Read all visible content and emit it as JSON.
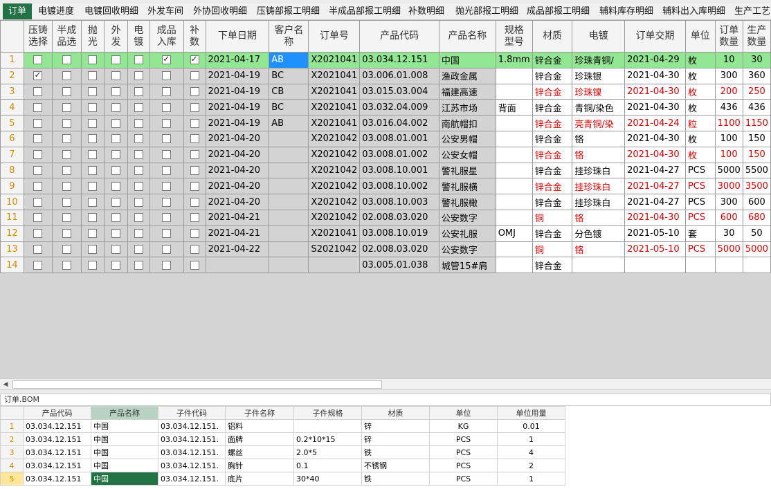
{
  "tabs": [
    {
      "label": "订单",
      "active": true
    },
    {
      "label": "电镀进度"
    },
    {
      "label": "电镀回收明细"
    },
    {
      "label": "外发车间"
    },
    {
      "label": "外协回收明细"
    },
    {
      "label": "压铸部报工明细"
    },
    {
      "label": "半成品部报工明细"
    },
    {
      "label": "补数明细"
    },
    {
      "label": "抛光部报工明细"
    },
    {
      "label": "成品部报工明细"
    },
    {
      "label": "辅料库存明细"
    },
    {
      "label": "辅料出入库明细"
    },
    {
      "label": "生产工艺"
    }
  ],
  "columns": [
    "压铸选择",
    "半成品选",
    "抛光",
    "外发",
    "电镀",
    "成品入库",
    "补数",
    "下单日期",
    "客户名称",
    "订单号",
    "产品代码",
    "产品名称",
    "规格型号",
    "材质",
    "电镀",
    "订单交期",
    "单位",
    "订单数量",
    "生产数量"
  ],
  "column_headers": [
    "压铸\n选择",
    "半成\n品选",
    "抛\n光",
    "外\n发",
    "电\n镀",
    "成品\n入库",
    "补\n数",
    "下单日期",
    "客户名\n称",
    "订单号",
    "产品代码",
    "产品名称",
    "规格\n型号",
    "材质",
    "电镀",
    "订单交期",
    "单位",
    "订单\n数量",
    "生产\n数量"
  ],
  "rows": [
    {
      "n": "1",
      "checks": [
        0,
        0,
        0,
        0,
        0,
        1,
        1
      ],
      "date": "2021-04-17",
      "customer": "AB",
      "order": "X2021041",
      "code": "03.034.12.151",
      "name": "中国",
      "spec": "1.8mm",
      "material": "锌合金",
      "plating": "珍珠青铜/",
      "due": "2021-04-29",
      "unit": "枚",
      "qty": "10",
      "prod": "30",
      "red": false,
      "selected": true
    },
    {
      "n": "2",
      "checks": [
        1,
        0,
        0,
        0,
        0,
        0,
        0
      ],
      "date": "2021-04-19",
      "customer": "BC",
      "order": "X2021041",
      "code": "03.006.01.008",
      "name": "渔政金属",
      "spec": "",
      "material": "锌合金",
      "plating": "珍珠银",
      "due": "2021-04-30",
      "unit": "枚",
      "qty": "300",
      "prod": "360",
      "red": false
    },
    {
      "n": "3",
      "checks": [
        0,
        0,
        0,
        0,
        0,
        0,
        0
      ],
      "date": "2021-04-19",
      "customer": "CB",
      "order": "X2021041",
      "code": "03.015.03.004",
      "name": "福建高速",
      "spec": "",
      "material": "锌合金",
      "plating": "珍珠镍",
      "due": "2021-04-30",
      "unit": "枚",
      "qty": "200",
      "prod": "250",
      "red": true
    },
    {
      "n": "4",
      "checks": [
        0,
        0,
        0,
        0,
        0,
        0,
        0
      ],
      "date": "2021-04-19",
      "customer": "BC",
      "order": "X2021041",
      "code": "03.032.04.009",
      "name": "江苏市场",
      "spec": "背面",
      "material": "锌合金",
      "plating": "青铜/染色",
      "due": "2021-04-30",
      "unit": "枚",
      "qty": "436",
      "prod": "436",
      "red": false
    },
    {
      "n": "5",
      "checks": [
        0,
        0,
        0,
        0,
        0,
        0,
        0
      ],
      "date": "2021-04-19",
      "customer": "AB",
      "order": "X2021041",
      "code": "03.016.04.002",
      "name": "南航帽扣",
      "spec": "",
      "material": "锌合金",
      "plating": "亮青铜/染",
      "due": "2021-04-24",
      "unit": "粒",
      "qty": "1100",
      "prod": "1150",
      "red": true
    },
    {
      "n": "6",
      "checks": [
        0,
        0,
        0,
        0,
        0,
        0,
        0
      ],
      "date": "2021-04-20",
      "customer": "",
      "order": "X2021042",
      "code": "03.008.01.001",
      "name": "公安男帽",
      "spec": "",
      "material": "锌合金",
      "plating": "铬",
      "due": "2021-04-30",
      "unit": "枚",
      "qty": "100",
      "prod": "150",
      "red": false
    },
    {
      "n": "7",
      "checks": [
        0,
        0,
        0,
        0,
        0,
        0,
        0
      ],
      "date": "2021-04-20",
      "customer": "",
      "order": "X2021042",
      "code": "03.008.01.002",
      "name": "公安女帽",
      "spec": "",
      "material": "锌合金",
      "plating": "铬",
      "due": "2021-04-30",
      "unit": "枚",
      "qty": "100",
      "prod": "150",
      "red": true
    },
    {
      "n": "8",
      "checks": [
        0,
        0,
        0,
        0,
        0,
        0,
        0
      ],
      "date": "2021-04-20",
      "customer": "",
      "order": "X2021042",
      "code": "03.008.10.001",
      "name": "警礼服星",
      "spec": "",
      "material": "锌合金",
      "plating": "挂珍珠白",
      "due": "2021-04-27",
      "unit": "PCS",
      "qty": "5000",
      "prod": "5500",
      "red": false
    },
    {
      "n": "9",
      "checks": [
        0,
        0,
        0,
        0,
        0,
        0,
        0
      ],
      "date": "2021-04-20",
      "customer": "",
      "order": "X2021042",
      "code": "03.008.10.002",
      "name": "警礼服横",
      "spec": "",
      "material": "锌合金",
      "plating": "挂珍珠白",
      "due": "2021-04-27",
      "unit": "PCS",
      "qty": "3000",
      "prod": "3500",
      "red": true
    },
    {
      "n": "10",
      "checks": [
        0,
        0,
        0,
        0,
        0,
        0,
        0
      ],
      "date": "2021-04-20",
      "customer": "",
      "order": "X2021042",
      "code": "03.008.10.003",
      "name": "警礼服橄",
      "spec": "",
      "material": "锌合金",
      "plating": "挂珍珠白",
      "due": "2021-04-27",
      "unit": "PCS",
      "qty": "300",
      "prod": "600",
      "red": false
    },
    {
      "n": "11",
      "checks": [
        0,
        0,
        0,
        0,
        0,
        0,
        0
      ],
      "date": "2021-04-21",
      "customer": "",
      "order": "X2021042",
      "code": "02.008.03.020",
      "name": "公安数字",
      "spec": "",
      "material": "铜",
      "plating": "铬",
      "due": "2021-04-30",
      "unit": "PCS",
      "qty": "600",
      "prod": "680",
      "red": true
    },
    {
      "n": "12",
      "checks": [
        0,
        0,
        0,
        0,
        0,
        0,
        0
      ],
      "date": "2021-04-21",
      "customer": "",
      "order": "X2021041",
      "code": "03.008.10.019",
      "name": "公安礼服",
      "spec": "OMJ",
      "material": "锌合金",
      "plating": "分色镀",
      "due": "2021-05-10",
      "unit": "套",
      "qty": "30",
      "prod": "50",
      "red": false
    },
    {
      "n": "13",
      "checks": [
        0,
        0,
        0,
        0,
        0,
        0,
        0
      ],
      "date": "2021-04-22",
      "customer": "",
      "order": "S2021042",
      "code": "02.008.03.020",
      "name": "公安数字",
      "spec": "",
      "material": "铜",
      "plating": "铬",
      "due": "2021-05-10",
      "unit": "PCS",
      "qty": "5000",
      "prod": "5000",
      "red": true
    },
    {
      "n": "14",
      "checks": [
        0,
        0,
        0,
        0,
        0,
        0,
        0
      ],
      "date": "",
      "customer": "",
      "order": "",
      "code": "03.005.01.038",
      "name": "城管15#肩",
      "spec": "",
      "material": "锌合金",
      "plating": "",
      "due": "",
      "unit": "",
      "qty": "",
      "prod": "",
      "red": false
    }
  ],
  "bom": {
    "title": "订单.BOM",
    "columns": [
      "产品代码",
      "产品名称",
      "子件代码",
      "子件名称",
      "子件规格",
      "材质",
      "单位",
      "单位用量"
    ],
    "rows": [
      {
        "n": "1",
        "code": "03.034.12.151",
        "name": "中国",
        "sub_code": "03.034.12.151.",
        "sub_name": "铝料",
        "sub_spec": "",
        "material": "锌",
        "unit": "KG",
        "usage": "0.01"
      },
      {
        "n": "2",
        "code": "03.034.12.151",
        "name": "中国",
        "sub_code": "03.034.12.151.",
        "sub_name": "面牌",
        "sub_spec": "0.2*10*15",
        "material": "锌",
        "unit": "PCS",
        "usage": "1"
      },
      {
        "n": "3",
        "code": "03.034.12.151",
        "name": "中国",
        "sub_code": "03.034.12.151.",
        "sub_name": "螺丝",
        "sub_spec": "2.0*5",
        "material": "铁",
        "unit": "PCS",
        "usage": "4"
      },
      {
        "n": "4",
        "code": "03.034.12.151",
        "name": "中国",
        "sub_code": "03.034.12.151.",
        "sub_name": "胸针",
        "sub_spec": "0.1",
        "material": "不锈钢",
        "unit": "PCS",
        "usage": "2"
      },
      {
        "n": "5",
        "code": "03.034.12.151",
        "name": "中国",
        "sub_code": "03.034.12.151.",
        "sub_name": "底片",
        "sub_spec": "30*40",
        "material": "铁",
        "unit": "PCS",
        "usage": "1"
      }
    ]
  },
  "colors": {
    "active_tab": "#217346",
    "selected_row": "#92e792",
    "highlight_cell": "#1e90ff",
    "warning_text": "#e00000"
  },
  "icons": {
    "scroll_left": "triangle-left-icon"
  }
}
